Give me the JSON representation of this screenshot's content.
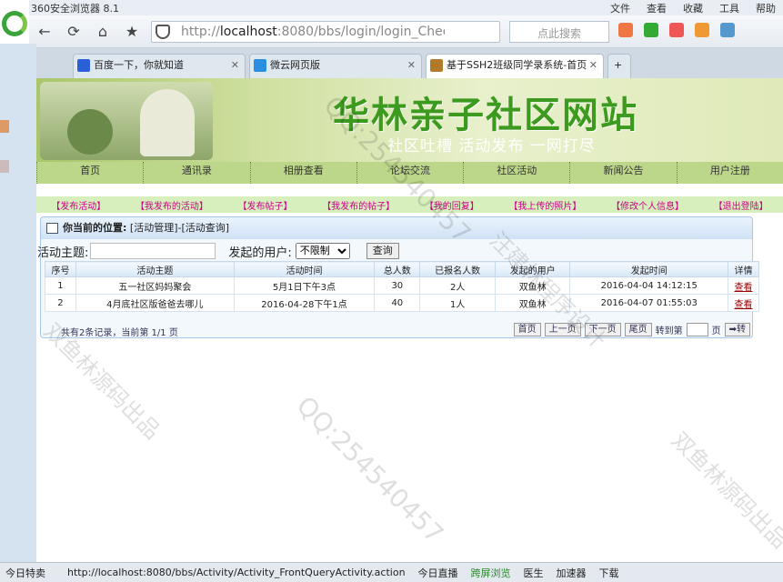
{
  "browser": {
    "title": "360安全浏览器 8.1",
    "menu": [
      "文件",
      "查看",
      "收藏",
      "工具",
      "帮助"
    ],
    "address_host": "localhost",
    "address_rest": ":8080/bbs/login/login_Chec",
    "address_prefix": "http://",
    "search_placeholder": "点此搜索",
    "tabs": [
      {
        "label": "百度一下，你就知道",
        "icon_color": "#2b5fd9"
      },
      {
        "label": "微云网页版",
        "icon_color": "#2a8fe0"
      },
      {
        "label": "基于SSH2班级同学录系统-首页",
        "icon_color": "#b07a2a"
      }
    ],
    "status_url": "http://localhost:8080/bbs/Activity/Activity_FrontQueryActivity.action",
    "status_left": "今日特卖",
    "status_items": [
      "今日直播",
      "跨屏浏览",
      "医生",
      "加速器",
      "下载"
    ]
  },
  "site": {
    "title": "华林亲子社区网站",
    "slogan": "社区吐槽 活动发布 一网打尽",
    "menu": [
      "首页",
      "通讯录",
      "相册查看",
      "论坛交流",
      "社区活动",
      "新闻公告",
      "用户注册"
    ],
    "subnav": [
      "【发布活动】",
      "【我发布的活动】",
      "【发布帖子】",
      "【我发布的帖子】",
      "【我的回复】",
      "【我上传的照片】",
      "【修改个人信息】",
      "【退出登陆】"
    ]
  },
  "panel": {
    "location_label": "你当前的位置:",
    "location_path": "[活动管理]-[活动查询]",
    "filter_topic_label": "活动主题:",
    "filter_user_label": "发起的用户:",
    "filter_user_value": "不限制",
    "query_button": "查询"
  },
  "table": {
    "headers": [
      "序号",
      "活动主题",
      "活动时间",
      "总人数",
      "已报名人数",
      "发起的用户",
      "发起时间",
      "详情"
    ],
    "rows": [
      [
        "1",
        "五一社区妈妈聚会",
        "5月1日下午3点",
        "30",
        "2人",
        "双鱼林",
        "2016-04-04 14:12:15",
        "查看"
      ],
      [
        "2",
        "4月底社区版爸爸去哪儿",
        "2016-04-28下午1点",
        "40",
        "1人",
        "双鱼林",
        "2016-04-07 01:55:03",
        "查看"
      ]
    ]
  },
  "pager": {
    "info": "共有2条记录，当前第 1/1 页",
    "first": "首页",
    "prev": "上一页",
    "next": "下一页",
    "last": "尾页",
    "goto_label": "转到第",
    "page_unit": "页",
    "goto_button": "➡转"
  },
  "watermarks": [
    "QQ:254540457",
    "汪建林程序设计",
    "双鱼林源码出品"
  ]
}
